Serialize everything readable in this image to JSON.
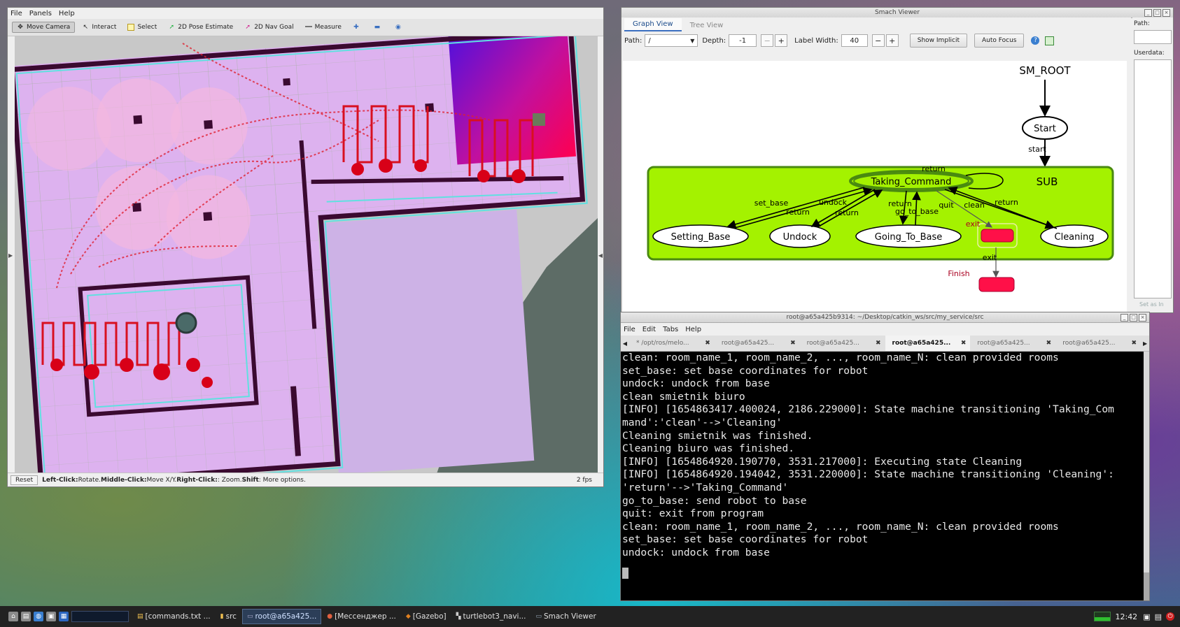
{
  "rviz": {
    "menu": [
      "File",
      "Panels",
      "Help"
    ],
    "tools": [
      {
        "label": "Move Camera",
        "icon": "camera-icon",
        "active": true
      },
      {
        "label": "Interact",
        "icon": "cursor-icon"
      },
      {
        "label": "Select",
        "icon": "select-box-icon"
      },
      {
        "label": "2D Pose Estimate",
        "icon": "pose-arrow-icon"
      },
      {
        "label": "2D Nav Goal",
        "icon": "goal-arrow-icon"
      },
      {
        "label": "Measure",
        "icon": "ruler-icon"
      }
    ],
    "status": {
      "reset": "Reset",
      "left_click": "Left-Click:",
      "left_desc": " Rotate. ",
      "middle_click": "Middle-Click:",
      "middle_desc": " Move X/Y. ",
      "right_click": "Right-Click:",
      "right_desc": ": Zoom. ",
      "shift": "Shift",
      "shift_desc": ": More options."
    },
    "fps": "2 fps"
  },
  "smach": {
    "title": "Smach Viewer",
    "tabs": [
      "Graph View",
      "Tree View"
    ],
    "path_label": "Path:",
    "path_value": "/",
    "depth_label": "Depth:",
    "depth_value": "-1",
    "label_width_label": "Label Width:",
    "label_width_value": "40",
    "show_implicit": "Show Implicit",
    "auto_focus": "Auto Focus",
    "right_path_label": "Path:",
    "userdata_label": "Userdata:",
    "set_as_initial": "Set as In",
    "graph": {
      "root": "SM_ROOT",
      "start": "Start",
      "start_edge": "start",
      "container": "SUB",
      "hub": "Taking_Command",
      "states": [
        "Setting_Base",
        "Undock",
        "Going_To_Base",
        "Cleaning"
      ],
      "finish": "Finish",
      "edge_labels": [
        "return",
        "set_base",
        "undock",
        "return",
        "return",
        "return",
        "go_to_base",
        "quit",
        "clean",
        "return",
        "exit",
        "exit"
      ]
    }
  },
  "terminal": {
    "title": "root@a65a425b9314: ~/Desktop/catkin_ws/src/my_service/src",
    "menu": [
      "File",
      "Edit",
      "Tabs",
      "Help"
    ],
    "tabs": [
      "* /opt/ros/melo...",
      "root@a65a425...",
      "root@a65a425...",
      "root@a65a425...",
      "root@a65a425...",
      "root@a65a425..."
    ],
    "active_tab": 3,
    "lines": [
      "clean: room_name_1, room_name_2, ..., room_name_N: clean provided rooms",
      "set_base: set base coordinates for robot",
      "undock: undock from base",
      "",
      "clean smietnik biuro",
      "[INFO] [1654863417.400024, 2186.229000]: State machine transitioning 'Taking_Com",
      "mand':'clean'-->'Cleaning'",
      "Cleaning smietnik was finished.",
      "Cleaning biuro was finished.",
      "[INFO] [1654864920.190770, 3531.217000]: Executing state Cleaning",
      "[INFO] [1654864920.194042, 3531.220000]: State machine transitioning 'Cleaning':",
      "'return'-->'Taking_Command'",
      "go_to_base: send robot to base",
      "quit: exit from program",
      "clean: room_name_1, room_name_2, ..., room_name_N: clean provided rooms",
      "set_base: set base coordinates for robot",
      "undock: undock from base"
    ]
  },
  "taskbar": {
    "items": [
      {
        "label": "[commands.txt ...",
        "icon": "text-file-icon"
      },
      {
        "label": "src",
        "icon": "folder-icon"
      },
      {
        "label": "root@a65a425...",
        "icon": "terminal-icon",
        "active": true
      },
      {
        "label": "[Мессенджер ...",
        "icon": "browser-icon"
      },
      {
        "label": "[Gazebo]",
        "icon": "gazebo-icon"
      },
      {
        "label": "turtlebot3_navi...",
        "icon": "rviz-icon"
      },
      {
        "label": "Smach Viewer",
        "icon": "window-icon"
      }
    ],
    "clock": "12:42"
  }
}
